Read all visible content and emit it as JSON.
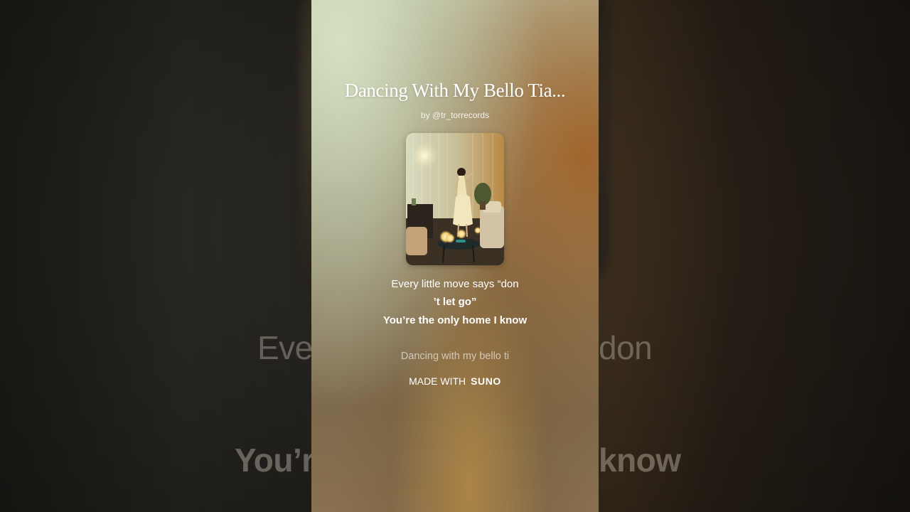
{
  "song": {
    "title": "Dancing With My Bello Tia...",
    "artist": "by @tr_torrecords"
  },
  "lyrics": {
    "line1": "Every little move says “don",
    "line2": "’t let go”",
    "line3": "You’re the only home I know",
    "next_line": "Dancing with my bello ti"
  },
  "background_lyrics": {
    "line1_left": "Eve",
    "line1_right": "don",
    "line2_left": "You’r",
    "line2_right": "know"
  },
  "footer": {
    "made_with": "MADE WITH",
    "brand": "SUNO"
  },
  "colors": {
    "text": "#ffffff",
    "panel_top": "#c9d0b4",
    "panel_accent": "#a0602a"
  }
}
